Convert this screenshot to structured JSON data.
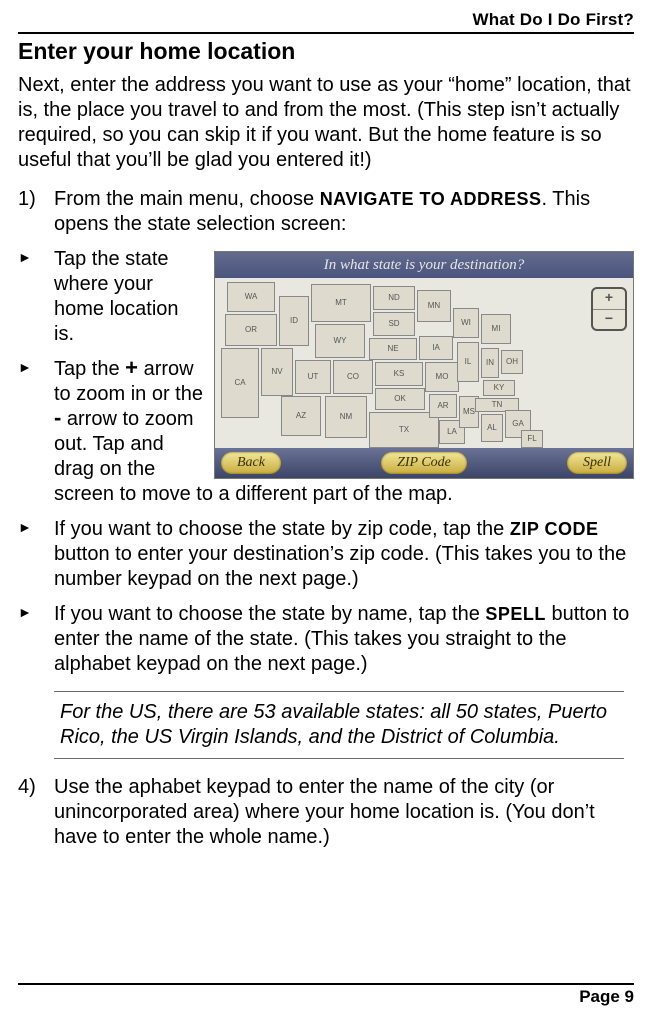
{
  "header": {
    "chapter": "What Do I Do First?"
  },
  "section": {
    "title": "Enter your home location"
  },
  "intro": "Next, enter the address you want to use as your “home” location, that is, the place you travel to and from the most. (This step isn’t actually required, so you can skip it if you want. But the home feature is so useful that you’ll be glad you entered it!)",
  "step1": {
    "pre": "From the main menu, choose ",
    "ui": "NAVIGATE TO ADDRESS",
    "post": ". This opens the state selection screen:"
  },
  "bullets": {
    "b1": "Tap the state where your home location is.",
    "b2": {
      "a": "Tap the ",
      "plus": "+",
      "b": " arrow to zoom in or the ",
      "minus": "-",
      "c": " arrow to zoom out. Tap and drag on the screen to move to a different part of the map."
    },
    "b3": {
      "a": "If you want to choose the state by zip code, tap the ",
      "ui": "ZIP CODE",
      "b": " button to enter your destination’s zip code. (This takes you to the number keypad on the next page.)"
    },
    "b4": {
      "a": "If you want to choose the state by name, tap the ",
      "ui": "SPELL",
      "b": " button to enter the name of the state. (This takes you straight to the alphabet keypad on the next page.)"
    }
  },
  "note": "For the US, there are 53 available states: all 50 states, Puerto Rico, the US Virgin Islands, and the District of Columbia.",
  "step4": "Use the aphabet keypad to enter the name of the city (or unincorporated area) where your home location is. (You don’t have to enter the whole name.)",
  "map": {
    "title": "In what state is your destination?",
    "buttons": {
      "back": "Back",
      "zip": "ZIP Code",
      "spell": "Spell"
    },
    "zoom": {
      "in": "+",
      "out": "−"
    },
    "states": [
      "WA",
      "OR",
      "CA",
      "NV",
      "ID",
      "MT",
      "WY",
      "UT",
      "AZ",
      "CO",
      "NM",
      "ND",
      "SD",
      "NE",
      "KS",
      "OK",
      "TX",
      "MN",
      "IA",
      "MO",
      "AR",
      "LA",
      "WI",
      "IL",
      "MS",
      "MI",
      "IN",
      "KY",
      "TN",
      "AL",
      "OH",
      "GA",
      "FL"
    ]
  },
  "footer": {
    "page": "Page 9"
  }
}
